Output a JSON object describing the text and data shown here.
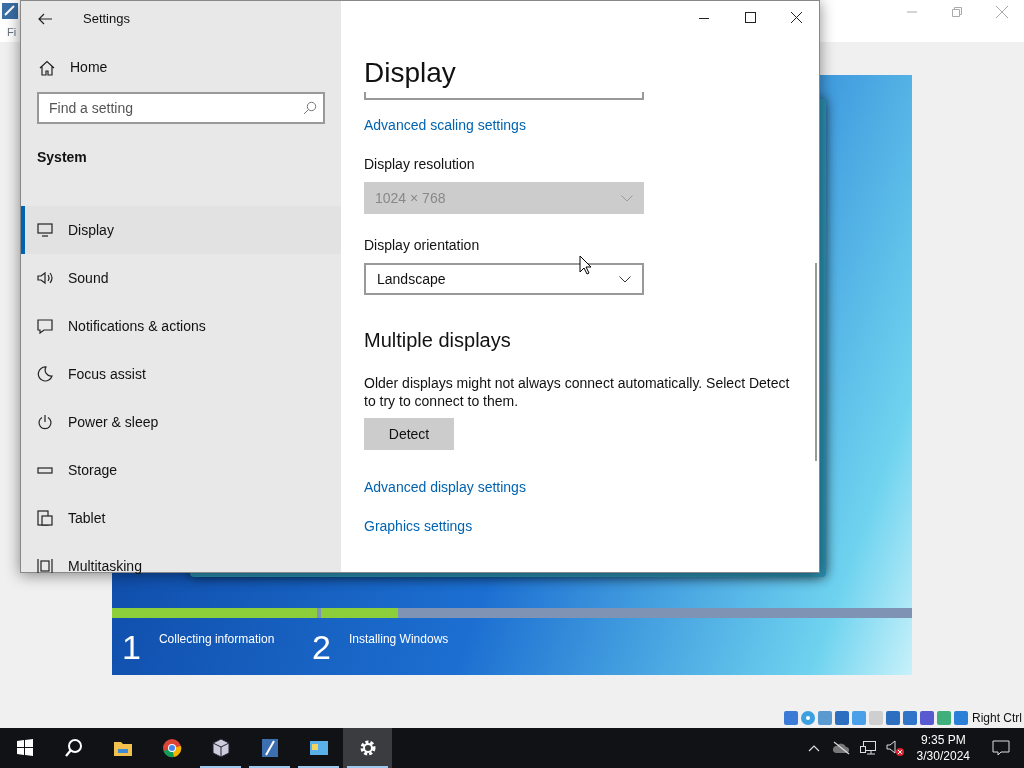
{
  "host_window": {
    "menu_fragment": "Fi"
  },
  "vm_screen": {
    "steps": [
      {
        "number": "1",
        "label": "Collecting information",
        "level": 1
      },
      {
        "number": "2",
        "label": "Installing Windows",
        "level": 0.13
      }
    ],
    "host_key": "Right Ctrl"
  },
  "settings": {
    "title": "Settings",
    "home": "Home",
    "search": {
      "placeholder": "Find a setting"
    },
    "section": "System",
    "nav": [
      {
        "label": "Display",
        "selected": true
      },
      {
        "label": "Sound",
        "selected": false
      },
      {
        "label": "Notifications & actions",
        "selected": false
      },
      {
        "label": "Focus assist",
        "selected": false
      },
      {
        "label": "Power & sleep",
        "selected": false
      },
      {
        "label": "Storage",
        "selected": false
      },
      {
        "label": "Tablet",
        "selected": false
      },
      {
        "label": "Multitasking",
        "selected": false
      }
    ],
    "page_title": "Display",
    "content": [
      {
        "kind": "cutfield"
      },
      {
        "kind": "link",
        "text": "Advanced scaling settings"
      },
      {
        "kind": "dropdown",
        "label": "Display resolution",
        "value": "1024 × 768",
        "disabled": true
      },
      {
        "kind": "dropdown",
        "label": "Display orientation",
        "value": "Landscape",
        "disabled": false
      },
      {
        "kind": "heading",
        "text": "Multiple displays"
      },
      {
        "kind": "paragraph",
        "text": "Older displays might not always connect automatically. Select Detect to try to connect to them."
      },
      {
        "kind": "button",
        "text": "Detect"
      },
      {
        "kind": "link",
        "text": "Advanced display settings"
      },
      {
        "kind": "link",
        "text": "Graphics settings"
      }
    ]
  },
  "taskbar": {
    "apps": [
      {
        "running": false,
        "selected": false
      },
      {
        "running": false,
        "selected": false
      },
      {
        "running": false,
        "selected": false
      },
      {
        "running": false,
        "selected": false
      },
      {
        "running": true,
        "selected": false
      },
      {
        "running": true,
        "selected": false
      },
      {
        "running": true,
        "selected": false
      },
      {
        "running": true,
        "selected": true
      }
    ],
    "time": "9:35 PM",
    "date": "3/30/2024"
  }
}
